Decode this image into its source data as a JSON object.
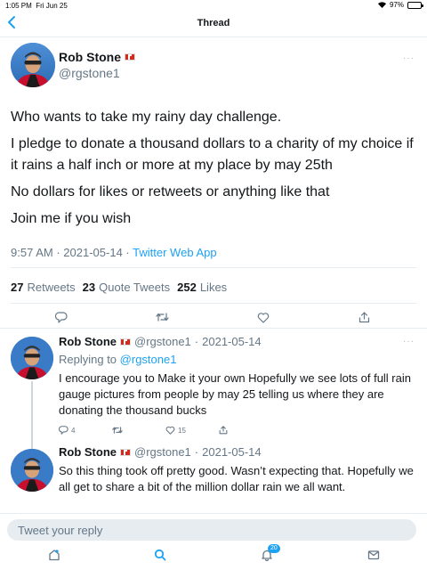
{
  "status_bar": {
    "time": "1:05 PM",
    "date": "Fri Jun 25",
    "battery": "97%",
    "battery_level": 0.97
  },
  "nav": {
    "title": "Thread"
  },
  "main_tweet": {
    "author_name": "Rob Stone",
    "handle": "@rgstone1",
    "paragraphs": [
      "Who wants to take my rainy day challenge.",
      "I pledge to donate a thousand dollars to a charity of my choice if it rains a half inch or more at my place by may 25th",
      "No dollars for likes or retweets or anything like that",
      "Join me if you wish"
    ],
    "time": "9:57 AM",
    "date": "2021-05-14",
    "separator": "·",
    "source": "Twitter Web App",
    "retweets_count": "27",
    "retweets_label": "Retweets",
    "quotes_count": "23",
    "quotes_label": "Quote Tweets",
    "likes_count": "252",
    "likes_label": "Likes"
  },
  "replies": [
    {
      "author_name": "Rob Stone",
      "handle": "@rgstone1",
      "date": "2021-05-14",
      "replying_label": "Replying to",
      "replying_to": "@rgstone1",
      "text": "I encourage you to Make it your own   Hopefully we see lots of full rain gauge pictures from people by may 25 telling us where they are donating the thousand bucks",
      "reply_count": "4",
      "like_count": "15"
    },
    {
      "author_name": "Rob Stone",
      "handle": "@rgstone1",
      "date": "2021-05-14",
      "text": "So this thing took off pretty good. Wasn’t expecting that. Hopefully we all get to share a bit of the million dollar rain we all want."
    }
  ],
  "compose": {
    "placeholder": "Tweet your reply"
  },
  "tabbar": {
    "notifications_badge": "20"
  },
  "colors": {
    "accent": "#1da1f2",
    "muted": "#657786",
    "flag_red": "#d52b1e"
  },
  "icons": [
    "back-chevron-icon",
    "wifi-icon",
    "battery-icon",
    "reply-icon",
    "retweet-icon",
    "like-icon",
    "share-icon",
    "home-icon",
    "search-icon",
    "notifications-icon",
    "messages-icon",
    "canada-flag-icon",
    "more-icon"
  ]
}
